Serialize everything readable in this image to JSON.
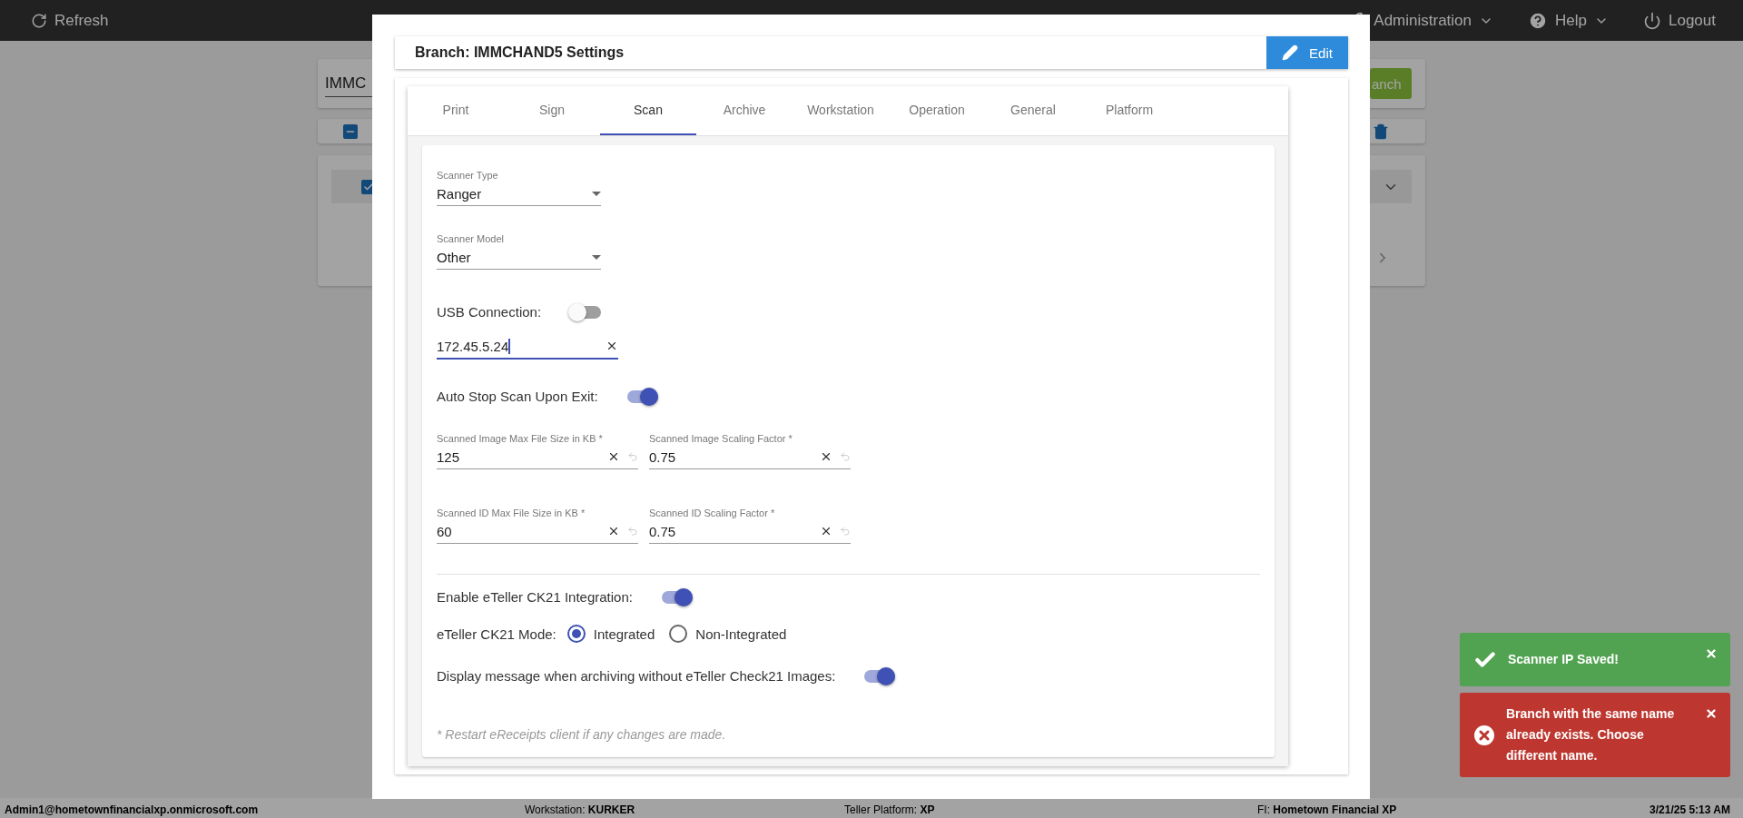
{
  "top_bar": {
    "refresh": "Refresh",
    "menus": [
      {
        "label": "Administration",
        "kind": "admin"
      },
      {
        "label": "Help",
        "kind": "help"
      },
      {
        "label": "Logout",
        "kind": "logout"
      }
    ]
  },
  "background": {
    "search_value": "IMMC",
    "search_button": "anch",
    "select_all_checked": true,
    "row_checked": true
  },
  "dialog": {
    "title": "Branch: IMMCHAND5 Settings",
    "edit_button": "Edit",
    "tabs": [
      {
        "label": "Print",
        "selected": false
      },
      {
        "label": "Sign",
        "selected": false
      },
      {
        "label": "Scan",
        "selected": true
      },
      {
        "label": "Archive",
        "selected": false
      },
      {
        "label": "Workstation",
        "selected": false
      },
      {
        "label": "Operation",
        "selected": false
      },
      {
        "label": "General",
        "selected": false
      },
      {
        "label": "Platform",
        "selected": false
      }
    ],
    "fields": [
      {
        "kind": "select",
        "label": "Scanner Type",
        "value": "Ranger"
      },
      {
        "kind": "select",
        "label": "Scanner Model",
        "value": "Other"
      },
      {
        "kind": "switch",
        "label": "USB Connection:",
        "on": false
      },
      {
        "kind": "text",
        "value": "172.45.5.24",
        "focused": true
      },
      {
        "kind": "switch",
        "label": "Auto Stop Scan Upon Exit:",
        "on": true
      },
      {
        "kind": "pair",
        "items": [
          {
            "label": "Scanned Image Max File Size in KB *",
            "value": "125"
          },
          {
            "label": "Scanned Image Scaling Factor *",
            "value": "0.75"
          }
        ]
      },
      {
        "kind": "pair",
        "items": [
          {
            "label": "Scanned ID Max File Size in KB *",
            "value": "60"
          },
          {
            "label": "Scanned ID Scaling Factor *",
            "value": "0.75"
          }
        ]
      },
      {
        "kind": "divider"
      },
      {
        "kind": "switch",
        "label": "Enable eTeller CK21 Integration:",
        "on": true
      },
      {
        "kind": "radio",
        "label": "eTeller CK21 Mode:",
        "options": [
          {
            "label": "Integrated",
            "selected": true
          },
          {
            "label": "Non-Integrated",
            "selected": false
          }
        ]
      },
      {
        "kind": "switch",
        "label": "Display message when archiving without eTeller Check21 Images:",
        "on": true
      }
    ],
    "footnote": "* Restart eReceipts client if any changes are made."
  },
  "toasts": [
    {
      "kind": "success",
      "message": "Scanner IP Saved!"
    },
    {
      "kind": "error",
      "message": "Branch with the same name already exists. Choose different name."
    }
  ],
  "status_bar": [
    {
      "value": "Admin1@hometownfinancialxp.onmicrosoft.com"
    },
    {
      "label": "Workstation:",
      "value": "KURKER"
    },
    {
      "label": "Teller Platform:",
      "value": "XP"
    },
    {
      "label": "FI:",
      "value": "Hometown Financial XP"
    },
    {
      "value": "3/21/25 5:13 AM"
    }
  ]
}
